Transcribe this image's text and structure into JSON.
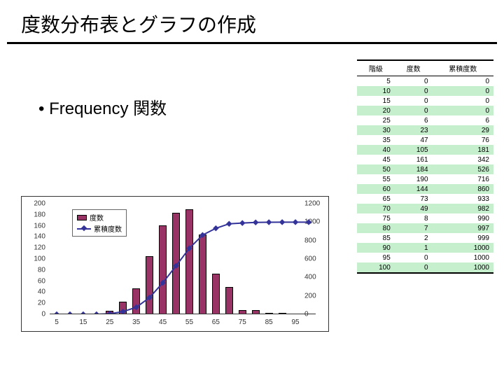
{
  "title": "度数分布表とグラフの作成",
  "bullet": "Frequency 関数",
  "table": {
    "headers": [
      "階級",
      "度数",
      "累積度数"
    ],
    "rows": [
      [
        5,
        0,
        0
      ],
      [
        10,
        0,
        0
      ],
      [
        15,
        0,
        0
      ],
      [
        20,
        0,
        0
      ],
      [
        25,
        6,
        6
      ],
      [
        30,
        23,
        29
      ],
      [
        35,
        47,
        76
      ],
      [
        40,
        105,
        181
      ],
      [
        45,
        161,
        342
      ],
      [
        50,
        184,
        526
      ],
      [
        55,
        190,
        716
      ],
      [
        60,
        144,
        860
      ],
      [
        65,
        73,
        933
      ],
      [
        70,
        49,
        982
      ],
      [
        75,
        8,
        990
      ],
      [
        80,
        7,
        997
      ],
      [
        85,
        2,
        999
      ],
      [
        90,
        1,
        1000
      ],
      [
        95,
        0,
        1000
      ],
      [
        100,
        0,
        1000
      ]
    ]
  },
  "chart_data": {
    "type": "combo",
    "title": "",
    "categories": [
      5,
      10,
      15,
      20,
      25,
      30,
      35,
      40,
      45,
      50,
      55,
      60,
      65,
      70,
      75,
      80,
      85,
      90,
      95,
      100
    ],
    "series": [
      {
        "name": "度数",
        "type": "bar",
        "axis": "left",
        "values": [
          0,
          0,
          0,
          0,
          6,
          23,
          47,
          105,
          161,
          184,
          190,
          144,
          73,
          49,
          8,
          7,
          2,
          1,
          0,
          0
        ]
      },
      {
        "name": "累積度数",
        "type": "line",
        "axis": "right",
        "values": [
          0,
          0,
          0,
          0,
          6,
          29,
          76,
          181,
          342,
          526,
          716,
          860,
          933,
          982,
          990,
          997,
          999,
          1000,
          1000,
          1000
        ]
      }
    ],
    "left_axis": {
      "min": 0,
      "max": 200,
      "ticks": [
        0,
        20,
        40,
        60,
        80,
        100,
        120,
        140,
        160,
        180,
        200
      ]
    },
    "right_axis": {
      "min": 0,
      "max": 1200,
      "ticks": [
        0,
        200,
        400,
        600,
        800,
        1000,
        1200
      ]
    },
    "x_ticks": [
      5,
      15,
      25,
      35,
      45,
      55,
      65,
      75,
      85,
      95
    ]
  },
  "legend": {
    "bar": "度数",
    "line": "累積度数"
  }
}
